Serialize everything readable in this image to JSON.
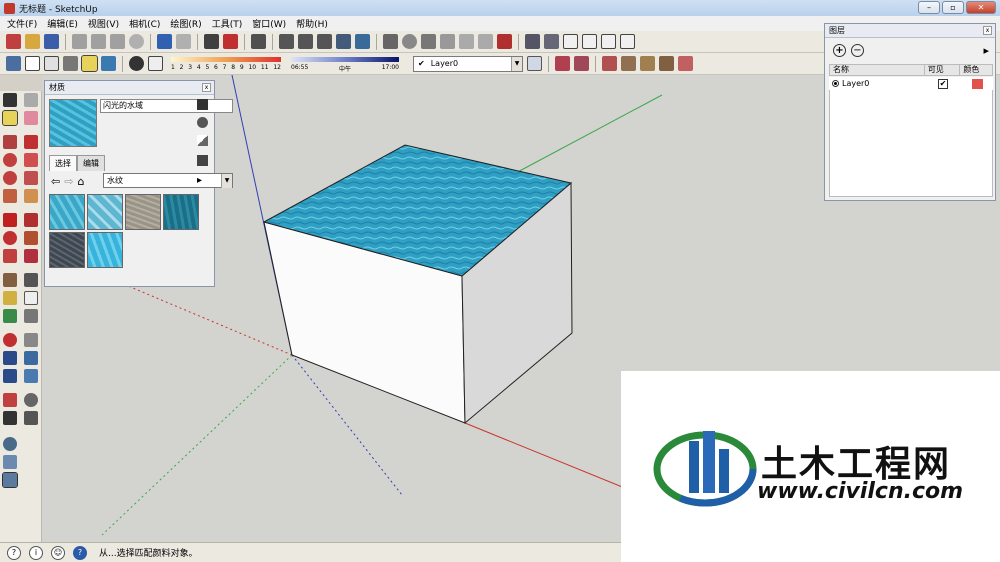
{
  "window": {
    "title": "无标题 - SketchUp",
    "min": "–",
    "max": "▫",
    "close": "✕"
  },
  "menu": [
    "文件(F)",
    "编辑(E)",
    "视图(V)",
    "相机(C)",
    "绘图(R)",
    "工具(T)",
    "窗口(W)",
    "帮助(H)"
  ],
  "shadow_scale": {
    "labels": [
      "1",
      "2",
      "3",
      "4",
      "5",
      "6",
      "7",
      "8",
      "9",
      "10",
      "11",
      "12"
    ]
  },
  "time_scale": {
    "start": "06:55",
    "mid": "中午",
    "end": "17:00"
  },
  "layer_select": {
    "check": "✔",
    "value": "Layer0"
  },
  "materials_panel": {
    "title": "材质",
    "close": "x",
    "name": "闪光的水域",
    "tabs": [
      "选择",
      "编辑"
    ],
    "category": "水纹",
    "swatch_colors": [
      "#3aa6c8",
      "#5eb6d0",
      "#9a9488",
      "#1a6f86",
      "#3e4750",
      "#36b4dc"
    ]
  },
  "layers_panel": {
    "title": "图层",
    "close": "x",
    "columns": [
      "名称",
      "可见",
      "颜色"
    ],
    "rows": [
      {
        "name": "Layer0",
        "visible": "✔",
        "color": "#e0524a"
      }
    ]
  },
  "status": {
    "text": "从...选择匹配颜料对象。"
  },
  "watermark": {
    "cn": "土木工程网",
    "url": "www.civilcn.com"
  },
  "colors": {
    "water": "#2f9fc3",
    "water_light": "#56c2dc",
    "viewport": "#d3d3cf",
    "axis_red": "#c8352a",
    "axis_green": "#3aa84a",
    "axis_blue": "#3040b0"
  }
}
